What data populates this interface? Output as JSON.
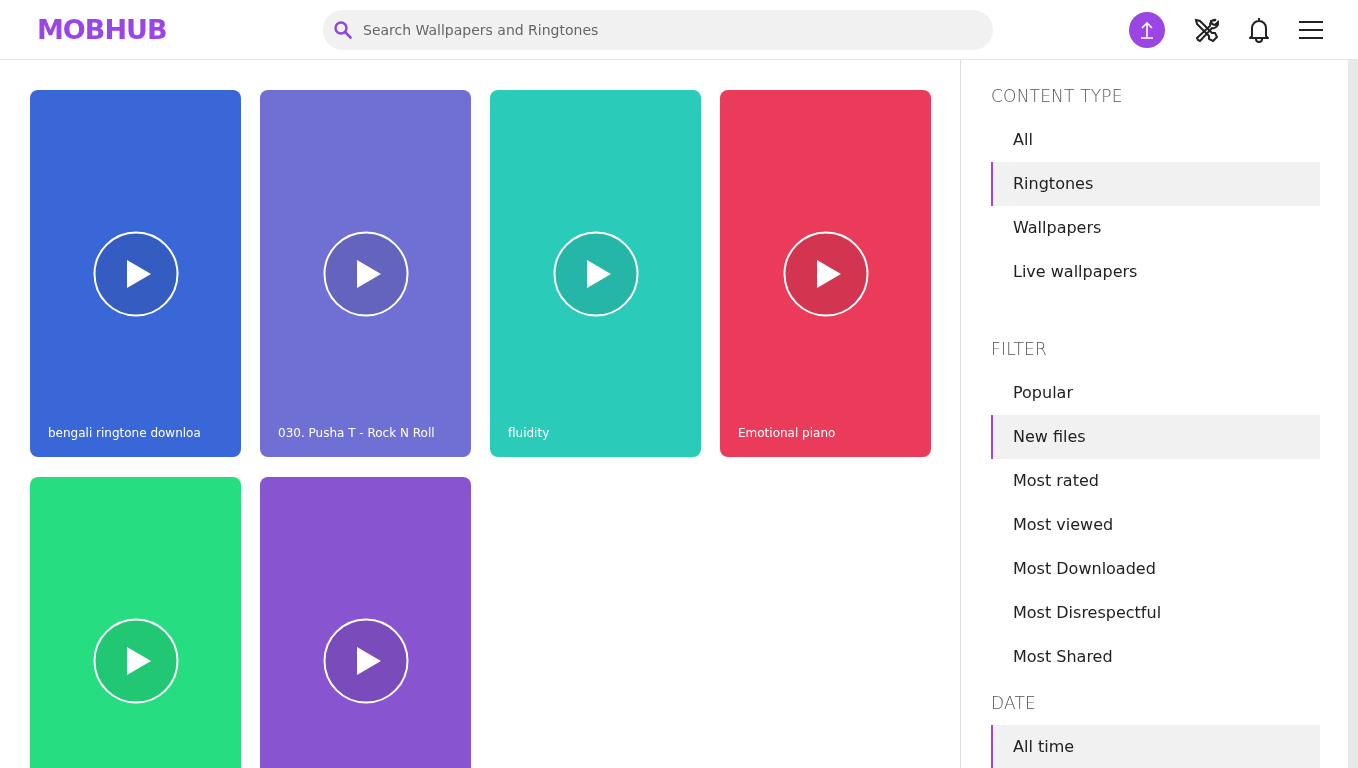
{
  "header": {
    "logo": "MOBHUB",
    "search": {
      "placeholder": "Search Wallpapers and Ringtones"
    }
  },
  "cards": [
    {
      "title": "bengali ringtone downloa",
      "color": "#3a67d7"
    },
    {
      "title": "030. Pusha T - Rock N Roll",
      "color": "#7070d4"
    },
    {
      "title": "fluidity",
      "color": "#2bcbba"
    },
    {
      "title": "Emotional piano",
      "color": "#eb3b5a"
    },
    {
      "color": "#26de81"
    },
    {
      "color": "#8854d0"
    }
  ],
  "sidebar": [
    {
      "title": "CONTENT TYPE",
      "items": [
        {
          "label": "All",
          "selected": false
        },
        {
          "label": "Ringtones",
          "selected": true
        },
        {
          "label": "Wallpapers",
          "selected": false
        },
        {
          "label": "Live wallpapers",
          "selected": false
        }
      ]
    },
    {
      "title": "FILTER",
      "items": [
        {
          "label": "Popular",
          "selected": false
        },
        {
          "label": "New files",
          "selected": true
        },
        {
          "label": "Most rated",
          "selected": false
        },
        {
          "label": "Most viewed",
          "selected": false
        },
        {
          "label": "Most Downloaded",
          "selected": false
        },
        {
          "label": "Most Disrespectful",
          "selected": false
        },
        {
          "label": "Most Shared",
          "selected": false
        }
      ]
    },
    {
      "title": "DATE",
      "items": [
        {
          "label": "All time",
          "selected": true
        }
      ]
    }
  ]
}
